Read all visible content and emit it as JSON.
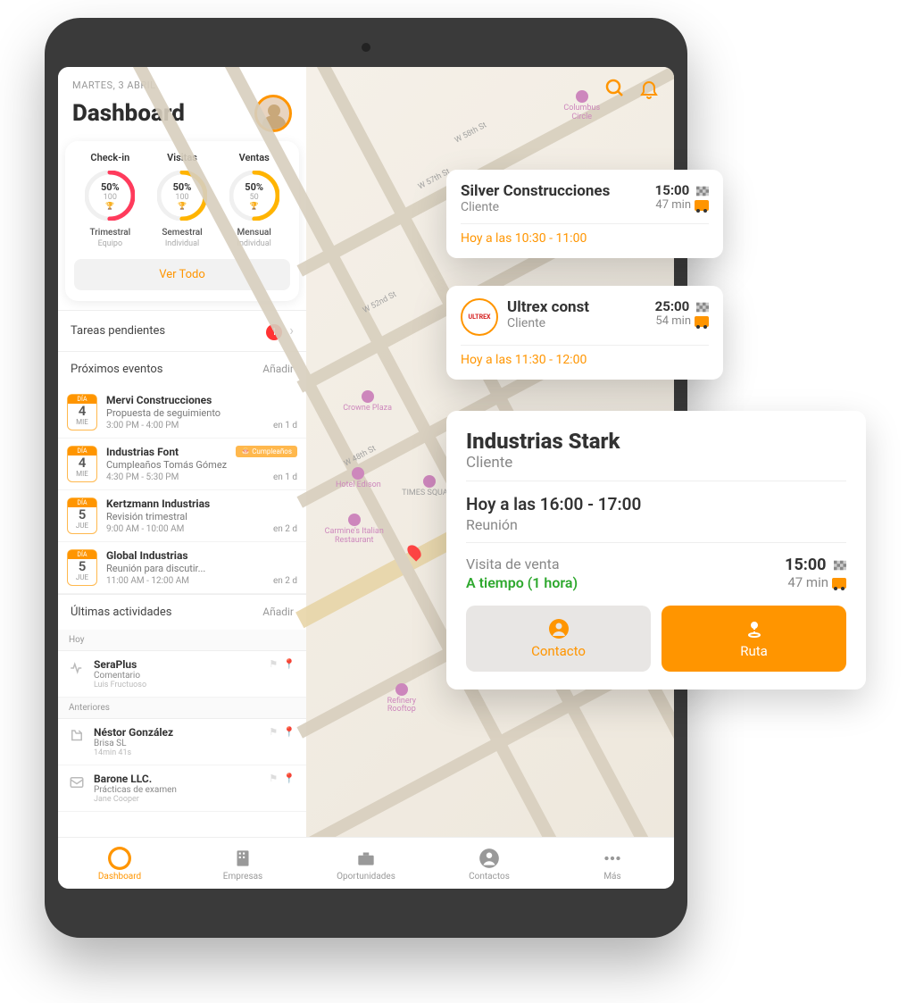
{
  "header": {
    "date": "MARTES, 3 ABRIL",
    "title": "Dashboard"
  },
  "kpis": {
    "items": [
      {
        "title": "Check-in",
        "pct": "50%",
        "sub": "100",
        "period": "Trimestral",
        "scope": "Equipo",
        "color": "#ff3b5c"
      },
      {
        "title": "Visitas",
        "pct": "50%",
        "sub": "100",
        "period": "Semestral",
        "scope": "Individual",
        "color": "#ffb400"
      },
      {
        "title": "Ventas",
        "pct": "50%",
        "sub": "50",
        "period": "Mensual",
        "scope": "Individual",
        "color": "#ffb400"
      }
    ],
    "ver_todo": "Ver Todo"
  },
  "pending": {
    "title": "Tareas pendientes",
    "count": "1"
  },
  "events": {
    "title": "Próximos eventos",
    "action": "Añadir",
    "items": [
      {
        "chip_label": "DÍA",
        "day": "4",
        "dow": "MIE",
        "title": "Mervi Construcciones",
        "sub": "Propuesta de seguimiento",
        "time": "3:00 PM - 4:00 PM",
        "due": "en 1 d",
        "tag": ""
      },
      {
        "chip_label": "DÍA",
        "day": "4",
        "dow": "MIE",
        "title": "Industrias Font",
        "sub": "Cumpleaños Tomás Gómez",
        "time": "4:30 PM - 5:30 PM",
        "due": "en 1 d",
        "tag": "Cumpleaños"
      },
      {
        "chip_label": "DÍA",
        "day": "5",
        "dow": "JUE",
        "title": "Kertzmann Industrias",
        "sub": "Revisión trimestral",
        "time": "9:00 AM - 10:00 AM",
        "due": "en 2 d",
        "tag": ""
      },
      {
        "chip_label": "DÍA",
        "day": "5",
        "dow": "JUE",
        "title": "Global Industrias",
        "sub": "Reunión para discutir...",
        "time": "11:00 AM - 12:00 AM",
        "due": "en 2 d",
        "tag": ""
      }
    ]
  },
  "activities": {
    "title": "Últimas actividades",
    "action": "Añadir",
    "today_label": "Hoy",
    "prev_label": "Anteriores",
    "today": [
      {
        "title": "SeraPlus",
        "sub": "Comentario",
        "sub2": "Luis Fructuoso"
      }
    ],
    "prev": [
      {
        "title": "Néstor González",
        "sub": "Brisa SL",
        "sub2": "14min 41s"
      },
      {
        "title": "Barone LLC.",
        "sub": "Prácticas de examen",
        "sub2": "Jane Cooper"
      }
    ]
  },
  "tabs": {
    "items": [
      {
        "label": "Dashboard"
      },
      {
        "label": "Empresas"
      },
      {
        "label": "Oportunidades"
      },
      {
        "label": "Contactos"
      },
      {
        "label": "Más"
      }
    ]
  },
  "map_cards": {
    "c1": {
      "title": "Silver Construcciones",
      "sub": "Cliente",
      "time": "15:00",
      "dur": "47 min",
      "slot": "Hoy a las 10:30 - 11:00"
    },
    "c2": {
      "logo": "ULTREX",
      "title": "Ultrex const",
      "sub": "Cliente",
      "time": "25:00",
      "dur": "54 min",
      "slot": "Hoy a las 11:30 - 12:00"
    },
    "c3": {
      "title": "Industrias Stark",
      "sub": "Cliente",
      "slot": "Hoy a las 16:00 - 17:00",
      "type": "Reunión",
      "visit": "Visita de venta",
      "on_time": "A tiempo  (1 hora)",
      "time": "15:00",
      "dur": "47 min",
      "btn_contact": "Contacto",
      "btn_route": "Ruta"
    }
  }
}
